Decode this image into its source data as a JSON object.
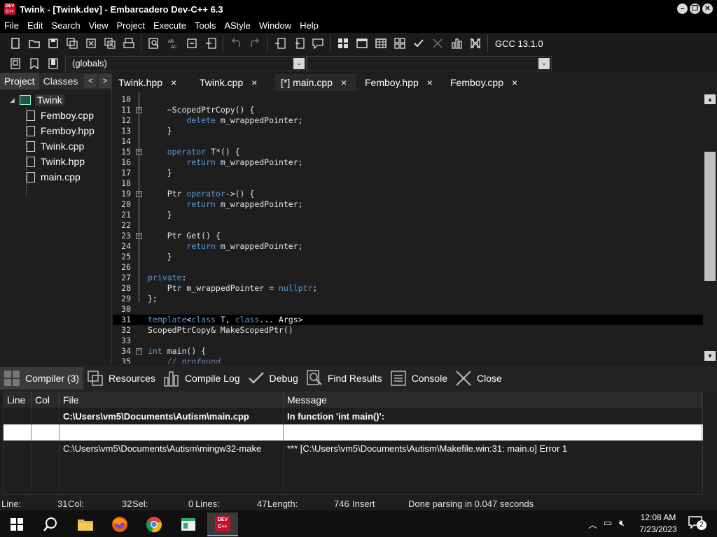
{
  "window": {
    "title": "Twink - [Twink.dev] - Embarcadero Dev-C++ 6.3",
    "app_icon_text": "DEV C++"
  },
  "menu": [
    "File",
    "Edit",
    "Search",
    "View",
    "Project",
    "Execute",
    "Tools",
    "AStyle",
    "Window",
    "Help"
  ],
  "toolbar": {
    "compiler_label": "GCC 13.1.0",
    "scope_combo_value": "(globals)"
  },
  "left_panel": {
    "tabs": [
      "Project",
      "Classes"
    ],
    "active_tab": "Project",
    "nav_prev": "<",
    "nav_next": ">",
    "project_name": "Twink",
    "files": [
      "Femboy.cpp",
      "Femboy.hpp",
      "Twink.cpp",
      "Twink.hpp",
      "main.cpp"
    ]
  },
  "editor": {
    "tabs": [
      {
        "label": "Twink.hpp",
        "active": false
      },
      {
        "label": "Twink.cpp",
        "active": false
      },
      {
        "label": "[*] main.cpp",
        "active": true
      },
      {
        "label": "Femboy.hpp",
        "active": false
      },
      {
        "label": "Femboy.cpp",
        "active": false
      }
    ],
    "close_glyph": "×",
    "lines": [
      {
        "num": "10",
        "text": ""
      },
      {
        "num": "11",
        "text": "    ~ScopedPtrCopy() {",
        "fold": true
      },
      {
        "num": "12",
        "text": "        delete m_wrappedPointer;"
      },
      {
        "num": "13",
        "text": "    }"
      },
      {
        "num": "14",
        "text": ""
      },
      {
        "num": "15",
        "text": "    operator T*() {",
        "fold": true
      },
      {
        "num": "16",
        "text": "        return m_wrappedPointer;"
      },
      {
        "num": "17",
        "text": "    }"
      },
      {
        "num": "18",
        "text": ""
      },
      {
        "num": "19",
        "text": "    Ptr operator->() {",
        "fold": true
      },
      {
        "num": "20",
        "text": "        return m_wrappedPointer;"
      },
      {
        "num": "21",
        "text": "    }"
      },
      {
        "num": "22",
        "text": ""
      },
      {
        "num": "23",
        "text": "    Ptr Get() {",
        "fold": true
      },
      {
        "num": "24",
        "text": "        return m_wrappedPointer;"
      },
      {
        "num": "25",
        "text": "    }"
      },
      {
        "num": "26",
        "text": ""
      },
      {
        "num": "27",
        "text": "private:"
      },
      {
        "num": "28",
        "text": "    Ptr m_wrappedPointer = nullptr;"
      },
      {
        "num": "29",
        "text": "};"
      },
      {
        "num": "30",
        "text": ""
      },
      {
        "num": "31",
        "text": "template<class T, class... Args>",
        "current": true
      },
      {
        "num": "32",
        "text": "ScopedPtrCopy& MakeScopedPtr()"
      },
      {
        "num": "33",
        "text": ""
      },
      {
        "num": "34",
        "text": "int main() {",
        "fold": true
      },
      {
        "num": "35",
        "text": "    // profound",
        "comment": true
      }
    ]
  },
  "bottom_tabs": [
    {
      "label": "Compiler (3)",
      "icon": "compiler-icon",
      "active": true
    },
    {
      "label": "Resources",
      "icon": "resources-icon"
    },
    {
      "label": "Compile Log",
      "icon": "compile-log-icon"
    },
    {
      "label": "Debug",
      "icon": "debug-check-icon"
    },
    {
      "label": "Find Results",
      "icon": "find-results-icon"
    },
    {
      "label": "Console",
      "icon": "console-icon"
    },
    {
      "label": "Close",
      "icon": "close-icon"
    }
  ],
  "messages": {
    "headers": [
      "Line",
      "Col",
      "File",
      "Message"
    ],
    "rows": [
      {
        "line": "",
        "col": "",
        "file": "C:\\Users\\vm5\\Documents\\Autism\\main.cpp",
        "message": "In function 'int main()':",
        "bold": true
      },
      {
        "line": "",
        "col": "",
        "file": "",
        "message": "",
        "selected": true
      },
      {
        "line": "",
        "col": "",
        "file": "C:\\Users\\vm5\\Documents\\Autism\\mingw32-make",
        "message": "*** [C:\\Users\\vm5\\Documents\\Autism\\Makefile.win:31: main.o] Error 1"
      }
    ]
  },
  "statusbar": {
    "line_label": "Line:",
    "line_value": "31",
    "col_label": "Col:",
    "col_value": "32",
    "sel_label": "Sel:",
    "sel_value": "0",
    "lines_label": "Lines:",
    "lines_value": "47",
    "length_label": "Length:",
    "length_value": "746",
    "mode": "Insert",
    "message": "Done parsing in 0.047 seconds"
  },
  "taskbar": {
    "time": "12:08 AM",
    "date": "7/23/2023",
    "notification_count": "2",
    "devcpp_label": "DEV C++"
  },
  "colors": {
    "keyword": "#5a9bd8",
    "comment": "#6e7fb0",
    "background": "#1e1e1e",
    "current_line": "#000000"
  }
}
